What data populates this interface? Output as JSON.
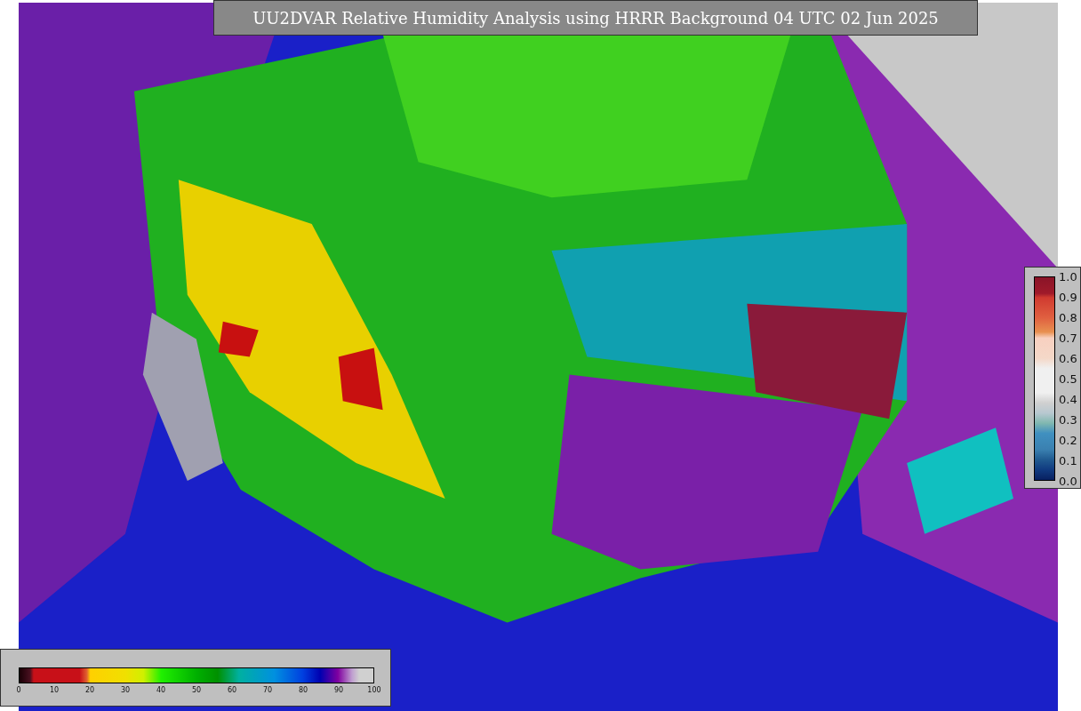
{
  "title": "UU2DVAR Relative Humidity Analysis using HRRR Background 04 UTC 02 Jun 2025",
  "humidity_colorbar": {
    "ticks": [
      "0",
      "10",
      "20",
      "30",
      "40",
      "50",
      "60",
      "70",
      "80",
      "90",
      "100"
    ]
  },
  "ratio_colorbar": {
    "ticks": [
      "1.0",
      "0.9",
      "0.8",
      "0.7",
      "0.6",
      "0.5",
      "0.4",
      "0.3",
      "0.2",
      "0.1",
      "0.0"
    ]
  }
}
